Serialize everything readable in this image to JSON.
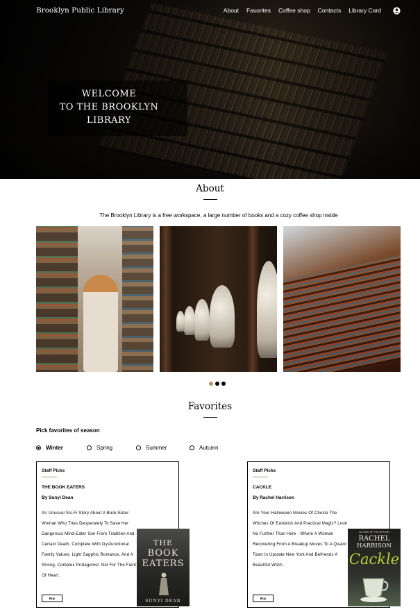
{
  "nav": {
    "brand": "Brooklyn Public Library",
    "links": [
      "About",
      "Favorites",
      "Coffee shop",
      "Contacts",
      "Library Card"
    ],
    "user_icon": "user-circle-icon"
  },
  "hero": {
    "welcome_line1": "WELCOME",
    "welcome_line2": "TO THE BROOKLYN",
    "welcome_line3": "LIBRARY"
  },
  "about": {
    "title": "About",
    "text": "The Brooklyn Library is a free workspace, a large number of books and a cozy coffee shop inside",
    "slider_active_index": 0,
    "slider_count": 3
  },
  "favorites": {
    "title": "Favorites",
    "pick_label": "Pick favorites of season",
    "seasons": [
      "Winter",
      "Spring",
      "Summer",
      "Autumn"
    ],
    "selected_season": "Winter",
    "cards": [
      {
        "staff_label": "Staff Picks",
        "title": "THE BOOK EATERS",
        "author": "By Sunyi Dean",
        "description": "An Unusual Sci-Fi Story About A Book Eater Woman Who Tries Desperately To Save Her Dangerous Mind-Eater Son From Tradition And Certain Death. Complete With Dysfunctional Family Values, Light Sapphic Romance, And A Strong, Complex Protagonist. Not For The Faint Of Heart.",
        "buy_label": "Buy",
        "cover": {
          "line1": "THE",
          "line2": "BOOK",
          "line3": "EATERS",
          "author": "SUNYI DEAN"
        }
      },
      {
        "staff_label": "Staff Picks",
        "title": "CACKLE",
        "author": "By Rachel Harrison",
        "description": "Are Your Halloween Movies Of Choice The Witches Of Eastwick And Practical Magic? Look No Further Than Here - Where A Woman Recovering From A Breakup Moves To A Quaint Town In Upstate New York And Befriends A Beautiful Witch.",
        "buy_label": "Buy",
        "cover": {
          "tag": "AUTHOR OF THE RETURN",
          "line1": "RACHEL",
          "line2": "HARRISON",
          "title": "Cackle"
        }
      }
    ]
  },
  "colors": {
    "accent": "#b3946a",
    "hero_bg": "#141210"
  }
}
